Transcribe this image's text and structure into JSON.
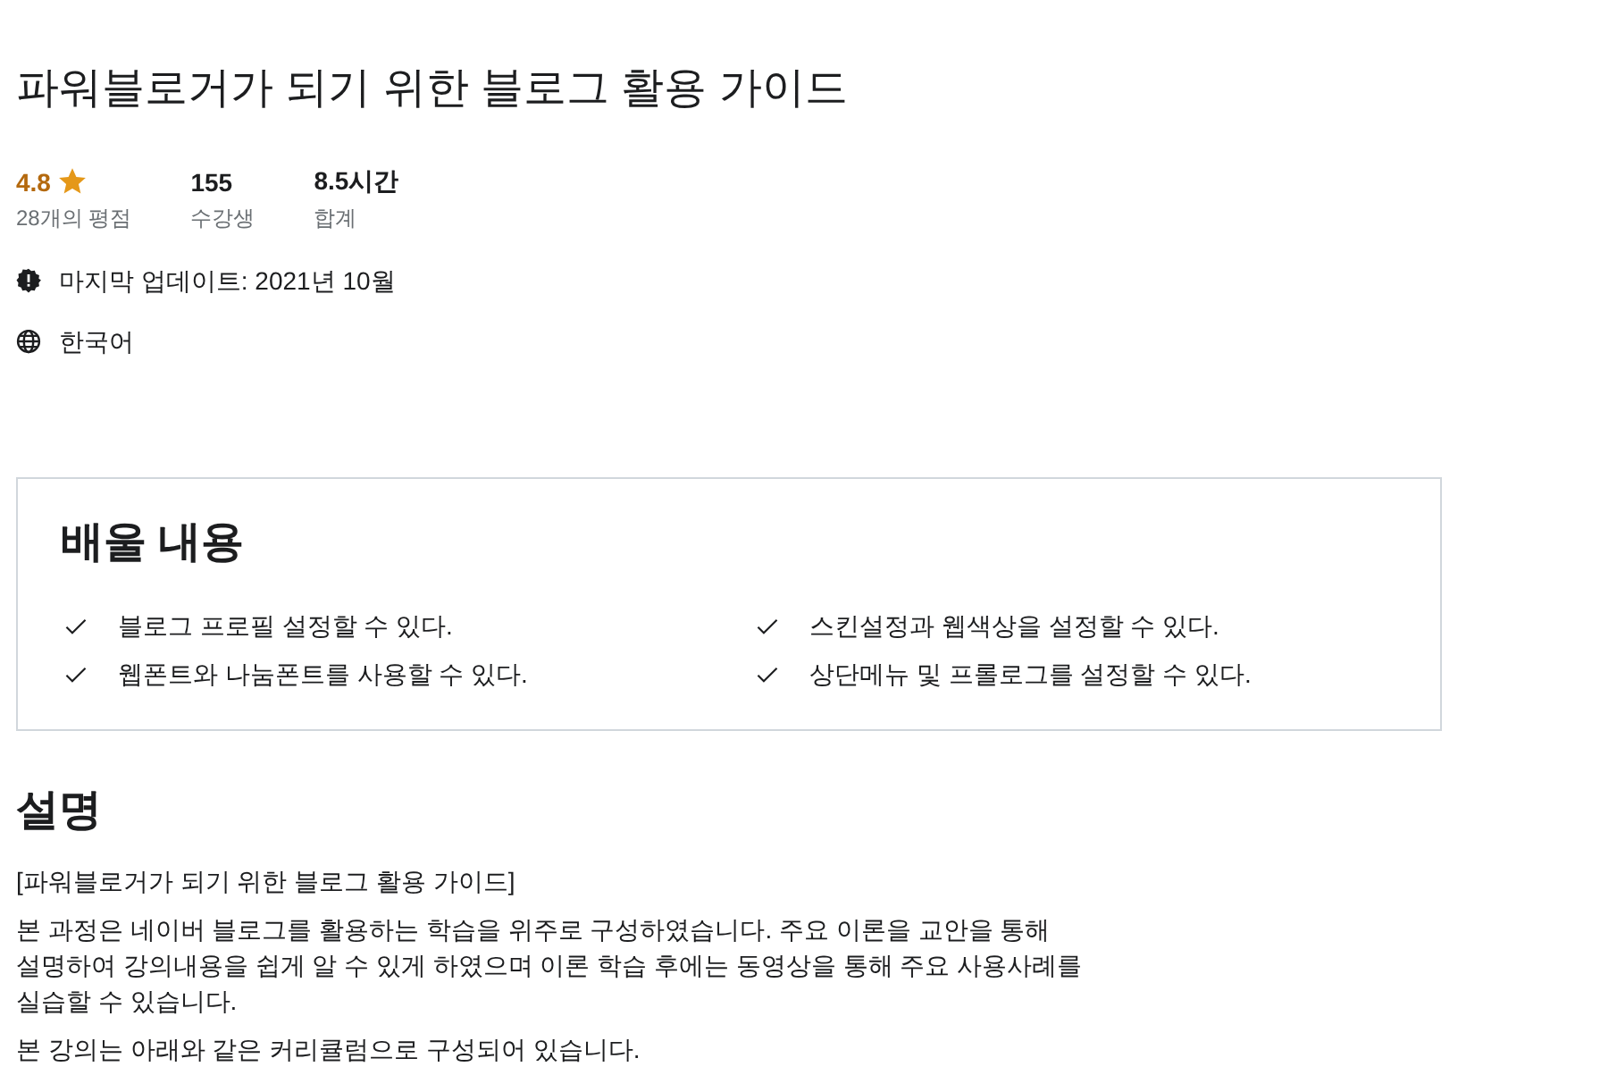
{
  "title": "파워블로거가 되기 위한 블로그 활용 가이드",
  "stats": [
    {
      "kind": "rating",
      "value": "4.8",
      "label": "28개의 평점"
    },
    {
      "kind": "plain",
      "value": "155",
      "label": "수강생"
    },
    {
      "kind": "plain",
      "value": "8.5시간",
      "label": "합계"
    }
  ],
  "meta": [
    {
      "kind": "update",
      "text": "마지막 업데이트: 2021년 10월"
    },
    {
      "kind": "language",
      "text": "한국어"
    }
  ],
  "learn": {
    "heading": "배울 내용",
    "items": [
      "블로그 프로필 설정할 수 있다.",
      "스킨설정과 웹색상을 설정할 수 있다.",
      "웹폰트와 나눔폰트를 사용할 수 있다.",
      "상단메뉴 및 프롤로그를 설정할 수 있다."
    ]
  },
  "description": {
    "heading": "설명",
    "paragraphs": [
      "[파워블로거가 되기 위한 블로그 활용 가이드]",
      "본 과정은 네이버 블로그를 활용하는 학습을 위주로 구성하였습니다. 주요 이론을 교안을 통해 설명하여 강의내용을 쉽게 알 수 있게 하였으며 이론 학습 후에는 동영상을 통해 주요 사용사례를 실습할 수 있습니다.",
      "본 강의는 아래와 같은 커리큘럼으로 구성되어 있습니다."
    ]
  }
}
